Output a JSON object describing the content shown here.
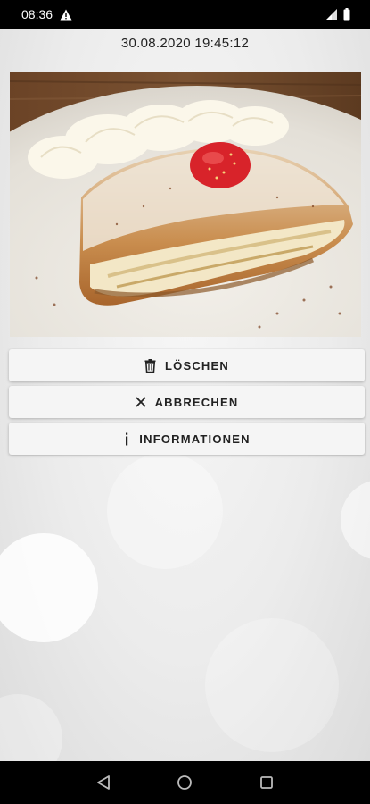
{
  "status_bar": {
    "time": "08:36",
    "icons": [
      "warning-icon",
      "signal-icon",
      "battery-icon"
    ]
  },
  "timestamp": "30.08.2020 19:45:12",
  "photo": {
    "subject": "apple-strudel-photo"
  },
  "actions": [
    {
      "label": "LÖSCHEN",
      "icon": "trash-icon"
    },
    {
      "label": "ABBRECHEN",
      "icon": "close-icon"
    },
    {
      "label": "INFORMATIONEN",
      "icon": "info-icon"
    }
  ],
  "nav_bar": {
    "buttons": [
      "back-icon",
      "home-icon",
      "recents-icon"
    ]
  },
  "colors": {
    "status_bar": "#000000",
    "nav_bar": "#000000",
    "button_bg": "#f5f5f5",
    "button_text": "#222222"
  }
}
